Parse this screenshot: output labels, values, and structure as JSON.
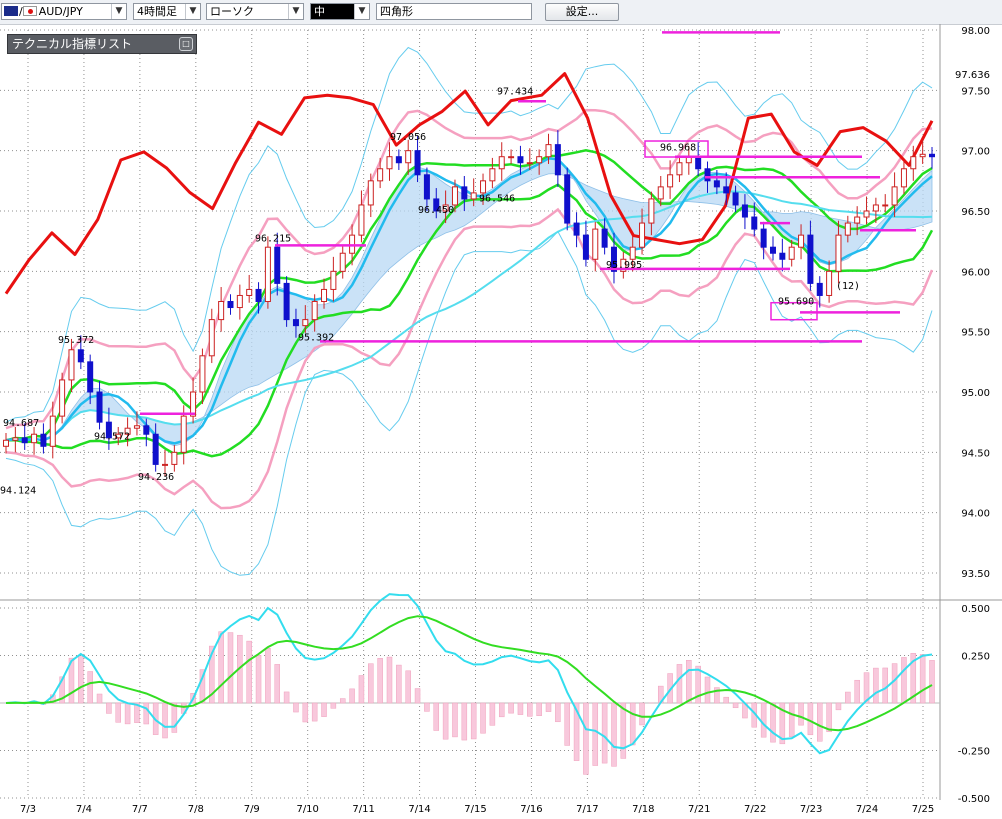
{
  "toolbar": {
    "symbol": "AUD/JPY",
    "timeframe": "4時間足",
    "chart_style": "ローソク",
    "pen_size": "中",
    "draw_shape": "四角形",
    "settings_label": "設定..."
  },
  "indicator_panel": {
    "title": "テクニカル指標リスト",
    "toggle_glyph": "□"
  },
  "colors": {
    "candle_up": "#cc2222",
    "candle_down": "#1010cc",
    "pct_line": "#e81010",
    "ma_short": "#22bbee",
    "ma_long": "#55ddee",
    "bb_mid": "#22dd22",
    "bb_inner": "#f5a0c0",
    "bb_outer": "#66ccee",
    "cloud": "#b8d8f4",
    "cloud_pink": "#f8c8dc",
    "marker": "#ee22dd",
    "grid": "#909090"
  },
  "chart_data": [
    {
      "type": "candlestick",
      "panel": "main",
      "title": "",
      "ylim": [
        93.5,
        98.0
      ],
      "yticks": [
        "98.00",
        "97.50",
        "97.00",
        "96.50",
        "96.00",
        "95.50",
        "95.00",
        "94.50",
        "94.00",
        "93.50"
      ],
      "last_price": "97.636",
      "xticks": [
        "7/3",
        "7/4",
        "7/7",
        "7/8",
        "7/9",
        "7/10",
        "7/11",
        "7/14",
        "7/15",
        "7/16",
        "7/17",
        "7/18",
        "7/21",
        "7/22",
        "7/23",
        "7/24",
        "7/25"
      ],
      "annotations": [
        {
          "text": "94.687",
          "price": 94.687
        },
        {
          "text": "95.372",
          "price": 95.372
        },
        {
          "text": "94.572",
          "price": 94.572
        },
        {
          "text": "94.236",
          "price": 94.236
        },
        {
          "text": "94.124",
          "price": 94.124
        },
        {
          "text": "96.215",
          "price": 96.215
        },
        {
          "text": "95.392",
          "price": 95.392
        },
        {
          "text": "97.056",
          "price": 97.056
        },
        {
          "text": "96.450",
          "price": 96.45
        },
        {
          "text": "96.546",
          "price": 96.546
        },
        {
          "text": "97.434",
          "price": 97.434
        },
        {
          "text": "95.995",
          "price": 95.995
        },
        {
          "text": "96.968",
          "price": 96.968
        },
        {
          "text": "95.690",
          "price": 95.69
        },
        {
          "text": "(12)",
          "price": 95.82
        }
      ],
      "closes": [
        94.6,
        94.62,
        94.58,
        94.65,
        94.55,
        94.8,
        95.1,
        95.35,
        95.25,
        95.0,
        94.75,
        94.62,
        94.65,
        94.7,
        94.72,
        94.65,
        94.4,
        94.4,
        94.5,
        94.8,
        95.0,
        95.3,
        95.6,
        95.75,
        95.7,
        95.8,
        95.85,
        95.75,
        96.2,
        95.9,
        95.6,
        95.55,
        95.6,
        95.75,
        95.85,
        96.0,
        96.15,
        96.3,
        96.55,
        96.75,
        96.85,
        96.95,
        96.9,
        97.0,
        96.8,
        96.6,
        96.5,
        96.55,
        96.7,
        96.6,
        96.65,
        96.75,
        96.85,
        96.95,
        96.95,
        96.9,
        96.9,
        96.95,
        97.05,
        96.8,
        96.4,
        96.3,
        96.1,
        96.35,
        96.2,
        96.0,
        96.1,
        96.2,
        96.4,
        96.6,
        96.7,
        96.8,
        96.9,
        96.95,
        96.85,
        96.75,
        96.7,
        96.65,
        96.55,
        96.45,
        96.35,
        96.2,
        96.15,
        96.1,
        96.2,
        96.3,
        95.9,
        95.8,
        96.0,
        96.3,
        96.4,
        96.45,
        96.5,
        96.55,
        96.55,
        96.7,
        96.85,
        96.95,
        96.97,
        96.95
      ],
      "pct_line_points": [
        [
          0,
          55
        ],
        [
          3,
          80
        ],
        [
          6,
          100
        ],
        [
          9,
          84
        ],
        [
          12,
          110
        ],
        [
          15,
          154
        ],
        [
          18,
          160
        ],
        [
          21,
          148
        ],
        [
          24,
          130
        ],
        [
          27,
          118
        ],
        [
          30,
          152
        ],
        [
          33,
          182
        ],
        [
          36,
          173
        ],
        [
          39,
          200
        ],
        [
          42,
          202
        ],
        [
          45,
          200
        ],
        [
          48,
          195
        ],
        [
          51,
          165
        ],
        [
          54,
          180
        ],
        [
          57,
          190
        ],
        [
          60,
          205
        ],
        [
          63,
          180
        ],
        [
          66,
          198
        ],
        [
          70,
          202
        ],
        [
          73,
          218
        ],
        [
          76,
          185
        ],
        [
          79,
          128
        ],
        [
          82,
          98
        ],
        [
          85,
          95
        ],
        [
          88,
          92
        ],
        [
          91,
          95
        ],
        [
          94,
          120
        ],
        [
          97,
          185
        ],
        [
          100,
          188
        ],
        [
          103,
          160
        ],
        [
          106,
          150
        ],
        [
          109,
          175
        ],
        [
          112,
          178
        ],
        [
          115,
          168
        ],
        [
          118,
          150
        ],
        [
          121,
          183
        ]
      ],
      "series_names": []
    },
    {
      "type": "line+bar",
      "panel": "macd",
      "title": "",
      "ylim": [
        -0.5,
        0.5
      ],
      "yticks": [
        "0.500",
        "0.250",
        "-0.250",
        "-0.500"
      ],
      "series_names": []
    }
  ]
}
